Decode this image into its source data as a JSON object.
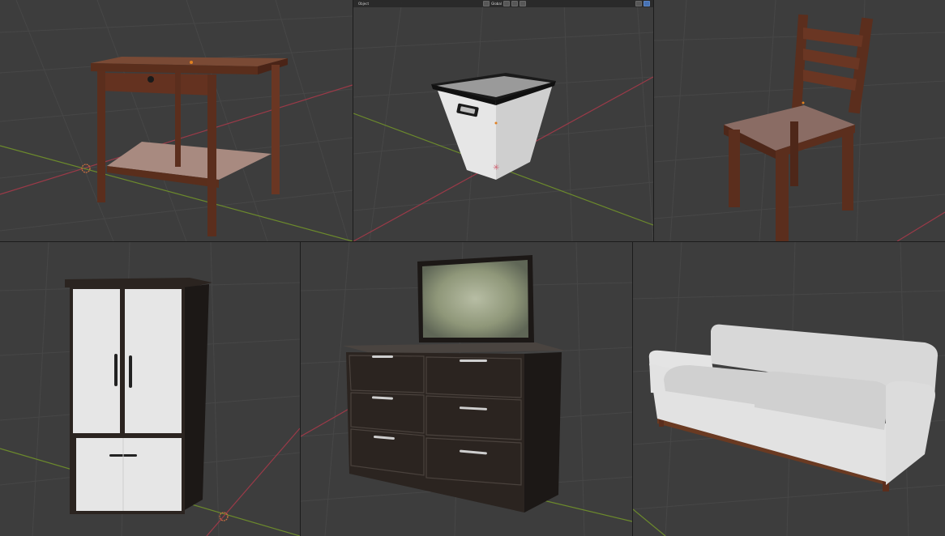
{
  "header": {
    "mode_label": "Object",
    "pivot_label": "Global",
    "icons": [
      "transform-pivot-icon",
      "snap-icon",
      "proportional-icon",
      "overlay-icon",
      "gizmo-icon"
    ]
  },
  "viewports": [
    {
      "object": "side-table"
    },
    {
      "object": "waste-basket"
    },
    {
      "object": "chair"
    },
    {
      "object": "wardrobe"
    },
    {
      "object": "dresser-with-mirror"
    },
    {
      "object": "sofa"
    }
  ],
  "colors": {
    "viewport_bg": "#3d3d3d",
    "grid": "#4a4a4a",
    "x_axis": "#9b3a48",
    "y_axis": "#6c8a2c",
    "wood": "#5a2e1c",
    "white_panel": "#e6e6e6",
    "dark_wood": "#2b2420",
    "fabric": "#d8d8d8",
    "accent_blue": "#4772b3"
  }
}
